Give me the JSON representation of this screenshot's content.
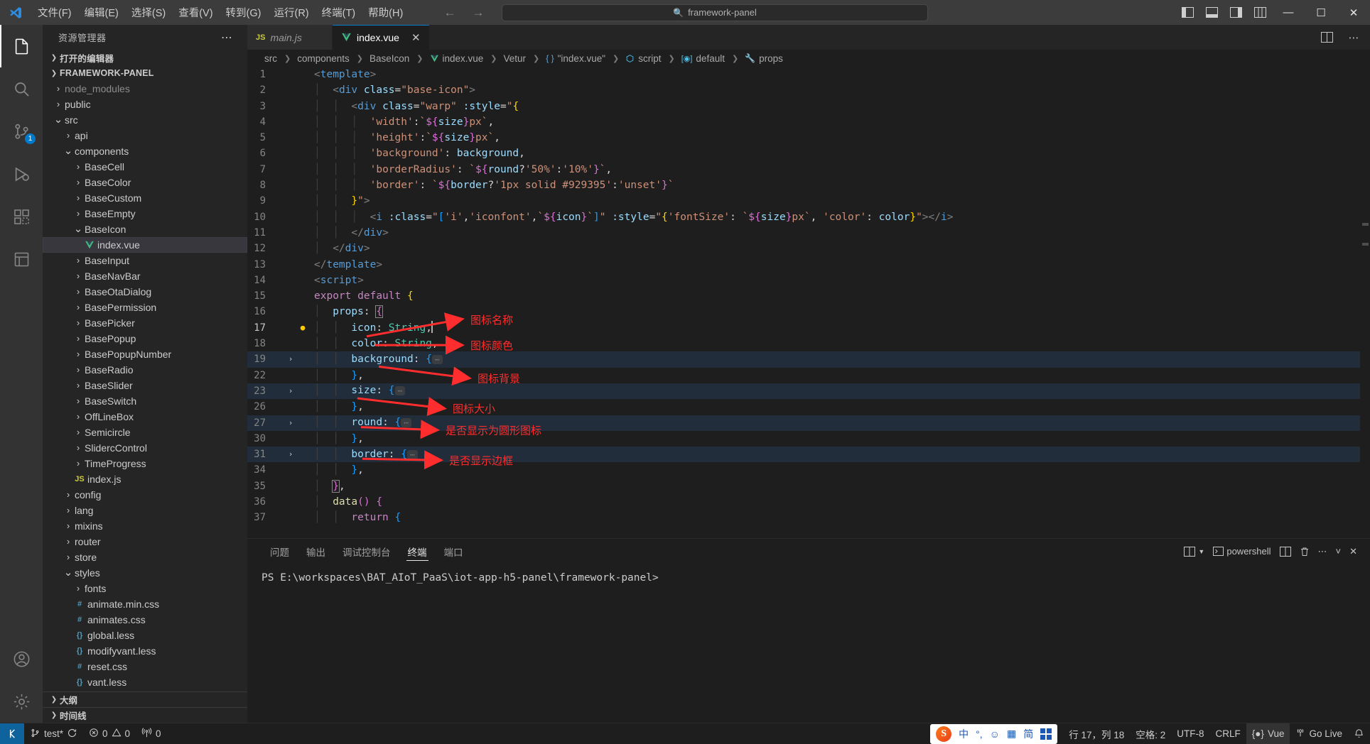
{
  "titlebar": {
    "logo_icon": "vscode-logo-icon",
    "menus": [
      "文件(F)",
      "编辑(E)",
      "选择(S)",
      "查看(V)",
      "转到(G)",
      "运行(R)",
      "终端(T)",
      "帮助(H)"
    ],
    "nav_back_icon": "arrow-left-icon",
    "nav_forward_icon": "arrow-right-icon",
    "command_center_text": "framework-panel",
    "command_center_icon": "search-icon",
    "layout_buttons": [
      {
        "name": "toggle-primary-sidebar",
        "icon": "layout-sidebar-left-icon"
      },
      {
        "name": "toggle-panel",
        "icon": "layout-panel-icon"
      },
      {
        "name": "toggle-secondary-sidebar",
        "icon": "layout-sidebar-right-icon"
      },
      {
        "name": "customize-layout",
        "icon": "layout-grid-icon"
      }
    ],
    "window_buttons": [
      {
        "name": "minimize-window-button",
        "glyph": "─"
      },
      {
        "name": "maximize-window-button",
        "glyph": "☐"
      },
      {
        "name": "close-window-button",
        "glyph": "✕"
      }
    ]
  },
  "activitybar": {
    "items": [
      {
        "name": "explorer",
        "icon": "files-icon",
        "active": true,
        "badge": ""
      },
      {
        "name": "search",
        "icon": "search-icon",
        "active": false,
        "badge": ""
      },
      {
        "name": "source-control",
        "icon": "source-control-icon",
        "active": false,
        "badge": "1"
      },
      {
        "name": "run-and-debug",
        "icon": "debug-icon",
        "active": false,
        "badge": ""
      },
      {
        "name": "extensions",
        "icon": "extensions-icon",
        "active": false,
        "badge": ""
      },
      {
        "name": "test-explorer",
        "icon": "beaker-icon",
        "active": false,
        "badge": ""
      }
    ],
    "bottom_items": [
      {
        "name": "accounts",
        "icon": "account-icon"
      },
      {
        "name": "manage-settings",
        "icon": "gear-icon"
      }
    ]
  },
  "sidebar": {
    "title": "资源管理器",
    "more_actions_icon": "ellipsis-icon",
    "open_editors_label": "打开的编辑器",
    "project_label": "FRAMEWORK-PANEL",
    "tree": [
      {
        "label": "node_modules",
        "depth": 1,
        "kind": "folder",
        "expanded": false,
        "dimmed": true
      },
      {
        "label": "public",
        "depth": 1,
        "kind": "folder",
        "expanded": false,
        "dimmed": false
      },
      {
        "label": "src",
        "depth": 1,
        "kind": "folder",
        "expanded": true,
        "dimmed": false
      },
      {
        "label": "api",
        "depth": 2,
        "kind": "folder",
        "expanded": false,
        "dimmed": false
      },
      {
        "label": "components",
        "depth": 2,
        "kind": "folder",
        "expanded": true,
        "dimmed": false
      },
      {
        "label": "BaseCell",
        "depth": 3,
        "kind": "folder",
        "expanded": false,
        "dimmed": false
      },
      {
        "label": "BaseColor",
        "depth": 3,
        "kind": "folder",
        "expanded": false,
        "dimmed": false
      },
      {
        "label": "BaseCustom",
        "depth": 3,
        "kind": "folder",
        "expanded": false,
        "dimmed": false
      },
      {
        "label": "BaseEmpty",
        "depth": 3,
        "kind": "folder",
        "expanded": false,
        "dimmed": false
      },
      {
        "label": "BaseIcon",
        "depth": 3,
        "kind": "folder",
        "expanded": true,
        "dimmed": false
      },
      {
        "label": "index.vue",
        "depth": 4,
        "kind": "vue",
        "expanded": false,
        "dimmed": false,
        "selected": true
      },
      {
        "label": "BaseInput",
        "depth": 3,
        "kind": "folder",
        "expanded": false,
        "dimmed": false
      },
      {
        "label": "BaseNavBar",
        "depth": 3,
        "kind": "folder",
        "expanded": false,
        "dimmed": false
      },
      {
        "label": "BaseOtaDialog",
        "depth": 3,
        "kind": "folder",
        "expanded": false,
        "dimmed": false
      },
      {
        "label": "BasePermission",
        "depth": 3,
        "kind": "folder",
        "expanded": false,
        "dimmed": false
      },
      {
        "label": "BasePicker",
        "depth": 3,
        "kind": "folder",
        "expanded": false,
        "dimmed": false
      },
      {
        "label": "BasePopup",
        "depth": 3,
        "kind": "folder",
        "expanded": false,
        "dimmed": false
      },
      {
        "label": "BasePopupNumber",
        "depth": 3,
        "kind": "folder",
        "expanded": false,
        "dimmed": false
      },
      {
        "label": "BaseRadio",
        "depth": 3,
        "kind": "folder",
        "expanded": false,
        "dimmed": false
      },
      {
        "label": "BaseSlider",
        "depth": 3,
        "kind": "folder",
        "expanded": false,
        "dimmed": false
      },
      {
        "label": "BaseSwitch",
        "depth": 3,
        "kind": "folder",
        "expanded": false,
        "dimmed": false
      },
      {
        "label": "OffLineBox",
        "depth": 3,
        "kind": "folder",
        "expanded": false,
        "dimmed": false
      },
      {
        "label": "Semicircle",
        "depth": 3,
        "kind": "folder",
        "expanded": false,
        "dimmed": false
      },
      {
        "label": "SlidercControl",
        "depth": 3,
        "kind": "folder",
        "expanded": false,
        "dimmed": false
      },
      {
        "label": "TimeProgress",
        "depth": 3,
        "kind": "folder",
        "expanded": false,
        "dimmed": false
      },
      {
        "label": "index.js",
        "depth": 3,
        "kind": "js",
        "expanded": false,
        "dimmed": false
      },
      {
        "label": "config",
        "depth": 2,
        "kind": "folder",
        "expanded": false,
        "dimmed": false
      },
      {
        "label": "lang",
        "depth": 2,
        "kind": "folder",
        "expanded": false,
        "dimmed": false
      },
      {
        "label": "mixins",
        "depth": 2,
        "kind": "folder",
        "expanded": false,
        "dimmed": false
      },
      {
        "label": "router",
        "depth": 2,
        "kind": "folder",
        "expanded": false,
        "dimmed": false
      },
      {
        "label": "store",
        "depth": 2,
        "kind": "folder",
        "expanded": false,
        "dimmed": false
      },
      {
        "label": "styles",
        "depth": 2,
        "kind": "folder",
        "expanded": true,
        "dimmed": false
      },
      {
        "label": "fonts",
        "depth": 3,
        "kind": "folder",
        "expanded": false,
        "dimmed": false
      },
      {
        "label": "animate.min.css",
        "depth": 3,
        "kind": "css",
        "expanded": false,
        "dimmed": false
      },
      {
        "label": "animates.css",
        "depth": 3,
        "kind": "css",
        "expanded": false,
        "dimmed": false
      },
      {
        "label": "global.less",
        "depth": 3,
        "kind": "less",
        "expanded": false,
        "dimmed": false
      },
      {
        "label": "modifyvant.less",
        "depth": 3,
        "kind": "less",
        "expanded": false,
        "dimmed": false
      },
      {
        "label": "reset.css",
        "depth": 3,
        "kind": "css",
        "expanded": false,
        "dimmed": false
      },
      {
        "label": "vant.less",
        "depth": 3,
        "kind": "less",
        "expanded": false,
        "dimmed": false
      }
    ],
    "outline_label": "大纲",
    "timeline_label": "时间线"
  },
  "tabs": {
    "items": [
      {
        "label": "main.js",
        "icon": "js-icon",
        "active": false,
        "preview": true,
        "close_icon": "close-icon"
      },
      {
        "label": "index.vue",
        "icon": "vue-icon",
        "active": true,
        "preview": false,
        "close_icon": "close-icon"
      }
    ],
    "actions": [
      {
        "name": "split-editor-button",
        "icon": "split-editor-icon"
      },
      {
        "name": "editor-more-actions-button",
        "icon": "ellipsis-icon"
      }
    ]
  },
  "breadcrumbs": [
    {
      "label": "src",
      "icon": ""
    },
    {
      "label": "components",
      "icon": ""
    },
    {
      "label": "BaseIcon",
      "icon": ""
    },
    {
      "label": "index.vue",
      "icon": "vue-icon"
    },
    {
      "label": "Vetur",
      "icon": ""
    },
    {
      "label": "\"index.vue\"",
      "icon": "braces-icon"
    },
    {
      "label": "script",
      "icon": "module-icon"
    },
    {
      "label": "default",
      "icon": "object-icon"
    },
    {
      "label": "props",
      "icon": "property-icon"
    }
  ],
  "editor": {
    "filename": "index.vue",
    "lines": [
      {
        "n": "1",
        "fold": "",
        "highlight": false
      },
      {
        "n": "2",
        "fold": "",
        "highlight": false
      },
      {
        "n": "3",
        "fold": "",
        "highlight": false
      },
      {
        "n": "4",
        "fold": "",
        "highlight": false
      },
      {
        "n": "5",
        "fold": "",
        "highlight": false
      },
      {
        "n": "6",
        "fold": "",
        "highlight": false
      },
      {
        "n": "7",
        "fold": "",
        "highlight": false
      },
      {
        "n": "8",
        "fold": "",
        "highlight": false
      },
      {
        "n": "9",
        "fold": "",
        "highlight": false
      },
      {
        "n": "10",
        "fold": "",
        "highlight": false
      },
      {
        "n": "11",
        "fold": "",
        "highlight": false
      },
      {
        "n": "12",
        "fold": "",
        "highlight": false
      },
      {
        "n": "13",
        "fold": "",
        "highlight": false
      },
      {
        "n": "14",
        "fold": "",
        "highlight": false
      },
      {
        "n": "15",
        "fold": "",
        "highlight": false
      },
      {
        "n": "16",
        "fold": "",
        "highlight": false
      },
      {
        "n": "17",
        "fold": "",
        "highlight": false
      },
      {
        "n": "18",
        "fold": "",
        "highlight": false
      },
      {
        "n": "19",
        "fold": "›",
        "highlight": true
      },
      {
        "n": "22",
        "fold": "",
        "highlight": false
      },
      {
        "n": "23",
        "fold": "›",
        "highlight": true
      },
      {
        "n": "26",
        "fold": "",
        "highlight": false
      },
      {
        "n": "27",
        "fold": "›",
        "highlight": true
      },
      {
        "n": "30",
        "fold": "",
        "highlight": false
      },
      {
        "n": "31",
        "fold": "›",
        "highlight": true
      },
      {
        "n": "34",
        "fold": "",
        "highlight": false
      },
      {
        "n": "35",
        "fold": "",
        "highlight": false
      },
      {
        "n": "36",
        "fold": "",
        "highlight": false
      },
      {
        "n": "37",
        "fold": "",
        "highlight": false
      }
    ],
    "code_text": [
      "<template>",
      "  <div class=\"base-icon\">",
      "    <div class=\"warp\" :style=\"{",
      "      'width':`${size}px`,",
      "      'height':`${size}px`,",
      "      'background': background,",
      "      'borderRadius': `${round?'50%':'10%'}`,",
      "      'border': `${border?'1px solid #929395':'unset'}`",
      "    }\">",
      "      <i :class=\"['i','iconfont',`${icon}`]\" :style=\"{'fontSize': `${size}px`, 'color': color}\"></i>",
      "    </div>",
      "  </div>",
      "</template>",
      "<script>",
      "export default {",
      "  props: {",
      "    icon: String,",
      "    color: String,",
      "    background: {…",
      "    },",
      "    size: {…",
      "    },",
      "    round: {…",
      "    },",
      "    border: {…",
      "    },",
      "  },",
      "  data() {",
      "    return {"
    ],
    "annotations": [
      {
        "text": "图标名称",
        "target_line": 17,
        "meaning": "icon-name-annotation"
      },
      {
        "text": "图标颜色",
        "target_line": 18,
        "meaning": "icon-color-annotation"
      },
      {
        "text": "图标背景",
        "target_line": 19,
        "meaning": "icon-background-annotation"
      },
      {
        "text": "图标大小",
        "target_line": 23,
        "meaning": "icon-size-annotation"
      },
      {
        "text": "是否显示为圆形图标",
        "target_line": 27,
        "meaning": "icon-round-annotation"
      },
      {
        "text": "是否显示边框",
        "target_line": 31,
        "meaning": "icon-border-annotation"
      }
    ],
    "annotation_color": "#ff2d2d"
  },
  "panel": {
    "tabs": [
      {
        "label": "问题",
        "active": false
      },
      {
        "label": "输出",
        "active": false
      },
      {
        "label": "调试控制台",
        "active": false
      },
      {
        "label": "终端",
        "active": true
      },
      {
        "label": "端口",
        "active": false
      }
    ],
    "actions": {
      "split_label": "",
      "shell_label": "powershell",
      "launch_profile_icon": "chevron-down-icon",
      "new_terminal_icon": "split-terminal-icon",
      "split_terminal_icon": "split-icon",
      "kill_terminal_icon": "trash-icon",
      "views_more_icon": "ellipsis-icon",
      "maximize_icon": "chevron-up-icon",
      "close_icon": "close-icon"
    },
    "terminal_prompt": "PS E:\\workspaces\\BAT_AIoT_PaaS\\iot-app-h5-panel\\framework-panel>"
  },
  "statusbar": {
    "remote_icon": "remote-window-icon",
    "branch_icon": "source-control-icon",
    "branch": "test*",
    "sync_icon": "sync-icon",
    "error_icon": "error-icon",
    "errors": "0",
    "warning_icon": "warning-icon",
    "warnings": "0",
    "radio_icon": "radio-tower-icon",
    "ports": "0",
    "ime": {
      "brand": "S",
      "mode": "中",
      "punct": "°,",
      "emoji_icon": "smiley-icon",
      "keyboard_icon": "keyboard-icon",
      "simplified": "简",
      "apps_icon": "apps-grid-icon"
    },
    "cursor_position": "行 17，列 18",
    "indentation": "空格: 2",
    "encoding": "UTF-8",
    "eol": "CRLF",
    "language_icon": "vue-brace-icon",
    "language": "Vue",
    "golive_icon": "broadcast-icon",
    "golive": "Go Live",
    "bell_icon": "bell-icon"
  },
  "colors": {
    "accent": "#007acc",
    "annotation_red": "#ff2d2d",
    "vue_green": "#41b883",
    "badge_blue": "#007acc"
  }
}
